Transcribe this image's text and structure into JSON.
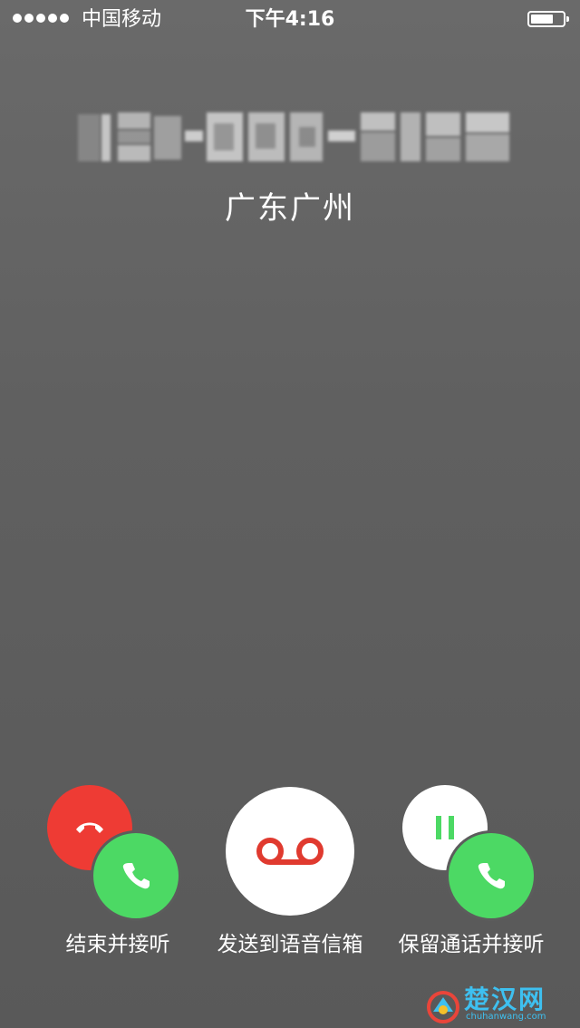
{
  "status_bar": {
    "carrier": "中国移动",
    "time": "下午4:16",
    "signal_bars": 5
  },
  "caller": {
    "number": "138-0000-2192",
    "location": "广东广州"
  },
  "actions": {
    "end_and_answer": {
      "label": "结束并接听",
      "icons": [
        "end-call-icon",
        "answer-call-icon"
      ]
    },
    "voicemail": {
      "label": "发送到语音信箱",
      "icons": [
        "voicemail-icon"
      ]
    },
    "hold_and_answer": {
      "label": "保留通话并接听",
      "icons": [
        "pause-icon",
        "answer-call-icon"
      ]
    }
  },
  "watermark": {
    "text": "楚汉网",
    "url": "chuhanwang.com"
  },
  "colors": {
    "background": "#5e5e5e",
    "end_red": "#ee3b34",
    "answer_green": "#4cd964",
    "voicemail_red": "#e03a2f",
    "hold_green": "#4cd964",
    "watermark_blue": "#3ec0f0"
  }
}
